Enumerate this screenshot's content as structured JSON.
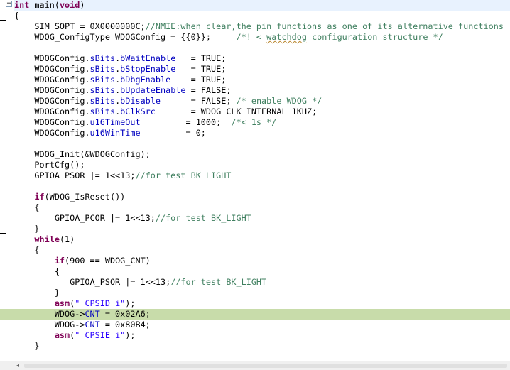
{
  "editor": {
    "lines": [
      {
        "tokens": [
          {
            "t": "int",
            "c": "kw"
          },
          {
            "t": " ",
            "c": ""
          },
          {
            "t": "main",
            "c": "fn"
          },
          {
            "t": "(",
            "c": ""
          },
          {
            "t": "void",
            "c": "kw"
          },
          {
            "t": ")",
            "c": ""
          }
        ]
      },
      {
        "tokens": [
          {
            "t": "{",
            "c": ""
          }
        ]
      },
      {
        "tokens": [
          {
            "t": "    SIM_SOPT = 0X0000000C;",
            "c": ""
          },
          {
            "t": "//NMIE:when clear,the pin functions as one of its alternative functions",
            "c": "cm"
          }
        ]
      },
      {
        "tokens": [
          {
            "t": "    WDOG_ConfigType WDOGConfig = {{0}};     ",
            "c": ""
          },
          {
            "t": "/*! < ",
            "c": "cm"
          },
          {
            "t": "watchdog",
            "c": "cm wavy"
          },
          {
            "t": " configuration structure */",
            "c": "cm"
          }
        ]
      },
      {
        "tokens": []
      },
      {
        "tokens": [
          {
            "t": "    WDOGConfig.",
            "c": ""
          },
          {
            "t": "sBits",
            "c": "fld"
          },
          {
            "t": ".",
            "c": ""
          },
          {
            "t": "bWaitEnable",
            "c": "fld"
          },
          {
            "t": "   = TRUE;",
            "c": ""
          }
        ]
      },
      {
        "tokens": [
          {
            "t": "    WDOGConfig.",
            "c": ""
          },
          {
            "t": "sBits",
            "c": "fld"
          },
          {
            "t": ".",
            "c": ""
          },
          {
            "t": "bStopEnable",
            "c": "fld"
          },
          {
            "t": "   = TRUE;",
            "c": ""
          }
        ]
      },
      {
        "tokens": [
          {
            "t": "    WDOGConfig.",
            "c": ""
          },
          {
            "t": "sBits",
            "c": "fld"
          },
          {
            "t": ".",
            "c": ""
          },
          {
            "t": "bDbgEnable",
            "c": "fld"
          },
          {
            "t": "    = TRUE;",
            "c": ""
          }
        ]
      },
      {
        "tokens": [
          {
            "t": "    WDOGConfig.",
            "c": ""
          },
          {
            "t": "sBits",
            "c": "fld"
          },
          {
            "t": ".",
            "c": ""
          },
          {
            "t": "bUpdateEnable",
            "c": "fld"
          },
          {
            "t": " = FALSE;",
            "c": ""
          }
        ]
      },
      {
        "tokens": [
          {
            "t": "    WDOGConfig.",
            "c": ""
          },
          {
            "t": "sBits",
            "c": "fld"
          },
          {
            "t": ".",
            "c": ""
          },
          {
            "t": "bDisable",
            "c": "fld"
          },
          {
            "t": "      = FALSE; ",
            "c": ""
          },
          {
            "t": "/* enable WDOG */",
            "c": "cm"
          }
        ]
      },
      {
        "tokens": [
          {
            "t": "    WDOGConfig.",
            "c": ""
          },
          {
            "t": "sBits",
            "c": "fld"
          },
          {
            "t": ".",
            "c": ""
          },
          {
            "t": "bClkSrc",
            "c": "fld"
          },
          {
            "t": "       = WDOG_CLK_INTERNAL_1KHZ;",
            "c": ""
          }
        ]
      },
      {
        "tokens": [
          {
            "t": "    WDOGConfig.",
            "c": ""
          },
          {
            "t": "u16TimeOut",
            "c": "fld"
          },
          {
            "t": "         = 1000;  ",
            "c": ""
          },
          {
            "t": "/*< 1s */",
            "c": "cm"
          }
        ]
      },
      {
        "tokens": [
          {
            "t": "    WDOGConfig.",
            "c": ""
          },
          {
            "t": "u16WinTime",
            "c": "fld"
          },
          {
            "t": "         = 0;",
            "c": ""
          }
        ]
      },
      {
        "tokens": []
      },
      {
        "tokens": [
          {
            "t": "    WDOG_Init(&WDOGConfig);",
            "c": ""
          }
        ]
      },
      {
        "tokens": [
          {
            "t": "    PortCfg();",
            "c": ""
          }
        ]
      },
      {
        "tokens": [
          {
            "t": "    GPIOA_PSOR |= 1<<13;",
            "c": ""
          },
          {
            "t": "//for test BK_LIGHT",
            "c": "cm"
          }
        ]
      },
      {
        "tokens": []
      },
      {
        "tokens": [
          {
            "t": "    ",
            "c": ""
          },
          {
            "t": "if",
            "c": "kw"
          },
          {
            "t": "(WDOG_IsReset())",
            "c": ""
          }
        ]
      },
      {
        "tokens": [
          {
            "t": "    {",
            "c": ""
          }
        ]
      },
      {
        "tokens": [
          {
            "t": "        GPIOA_PCOR |= 1<<13;",
            "c": ""
          },
          {
            "t": "//for test BK_LIGHT",
            "c": "cm"
          }
        ]
      },
      {
        "tokens": [
          {
            "t": "    }",
            "c": ""
          }
        ]
      },
      {
        "tokens": [
          {
            "t": "    ",
            "c": ""
          },
          {
            "t": "while",
            "c": "kw"
          },
          {
            "t": "(1)",
            "c": ""
          }
        ]
      },
      {
        "tokens": [
          {
            "t": "    {",
            "c": ""
          }
        ]
      },
      {
        "tokens": [
          {
            "t": "        ",
            "c": ""
          },
          {
            "t": "if",
            "c": "kw"
          },
          {
            "t": "(900 == WDOG_CNT)",
            "c": ""
          }
        ]
      },
      {
        "tokens": [
          {
            "t": "        {",
            "c": ""
          }
        ]
      },
      {
        "tokens": [
          {
            "t": "           GPIOA_PSOR |= 1<<13;",
            "c": ""
          },
          {
            "t": "//for test BK_LIGHT",
            "c": "cm"
          }
        ]
      },
      {
        "tokens": [
          {
            "t": "        }",
            "c": ""
          }
        ]
      },
      {
        "tokens": [
          {
            "t": "        ",
            "c": ""
          },
          {
            "t": "asm",
            "c": "kw"
          },
          {
            "t": "(",
            "c": ""
          },
          {
            "t": "\" CPSID i\"",
            "c": "str"
          },
          {
            "t": ");",
            "c": ""
          }
        ]
      },
      {
        "tokens": [
          {
            "t": "        WDOG->",
            "c": ""
          },
          {
            "t": "CNT",
            "c": "fld"
          },
          {
            "t": " = 0x02A6;",
            "c": ""
          }
        ],
        "highlight": true
      },
      {
        "tokens": [
          {
            "t": "        WDOG->",
            "c": ""
          },
          {
            "t": "CNT",
            "c": "fld"
          },
          {
            "t": " = 0x80B4;",
            "c": ""
          }
        ]
      },
      {
        "tokens": [
          {
            "t": "        ",
            "c": ""
          },
          {
            "t": "asm",
            "c": "kw"
          },
          {
            "t": "(",
            "c": ""
          },
          {
            "t": "\" CPSIE i\"",
            "c": "str"
          },
          {
            "t": ");",
            "c": ""
          }
        ]
      },
      {
        "tokens": [
          {
            "t": "    }",
            "c": ""
          }
        ]
      }
    ],
    "current_line_index": 0,
    "highlighted_line_index": 29
  },
  "gutter": {
    "fold_icon": "minus",
    "change_markers_at_lines": [
      1,
      21
    ]
  },
  "scrollbar": {
    "left_arrow": "◂"
  },
  "colors": {
    "keyword": "#7f0055",
    "comment": "#3f7f5f",
    "field": "#0000c0",
    "string": "#2a00ff",
    "current_line": "#e8f2fe",
    "execution_line": "#c8dcaa"
  }
}
